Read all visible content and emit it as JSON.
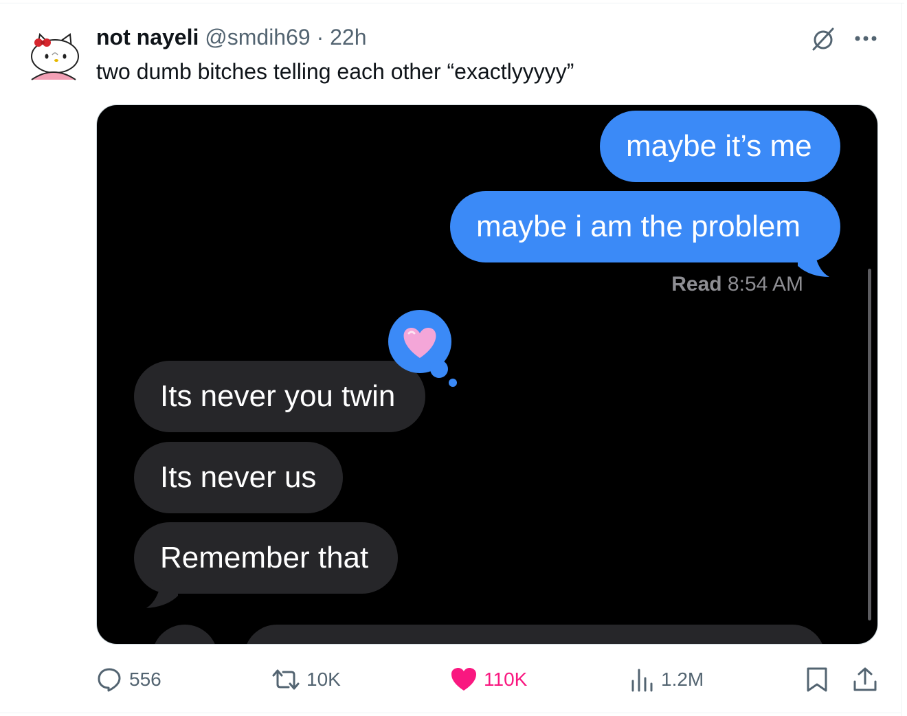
{
  "tweet": {
    "author_name": "not nayeli",
    "handle": "@smdih69",
    "separator": "·",
    "time": "22h",
    "text": "two dumb bitches telling each other “exactlyyyyy”"
  },
  "media": {
    "messages": [
      {
        "text": "maybe it’s me",
        "direction": "sent"
      },
      {
        "text": "maybe i am the problem",
        "direction": "sent"
      },
      {
        "text": "Its never you twin",
        "direction": "received"
      },
      {
        "text": "Its never us",
        "direction": "received"
      },
      {
        "text": "Remember that",
        "direction": "received"
      }
    ],
    "read_label": "Read",
    "read_time": "8:54 AM",
    "reaction": "heart-emoji",
    "colors": {
      "sent": "#3b8af7",
      "received": "#262629",
      "background": "#000000"
    }
  },
  "actions": {
    "replies": "556",
    "reposts": "10K",
    "likes": "110K",
    "views": "1.2M",
    "like_color": "#f91880"
  },
  "icons": [
    "avatar-hello-kitty",
    "grok-icon",
    "more-icon",
    "reply-icon",
    "repost-icon",
    "like-icon",
    "views-icon",
    "bookmark-icon",
    "share-icon"
  ]
}
